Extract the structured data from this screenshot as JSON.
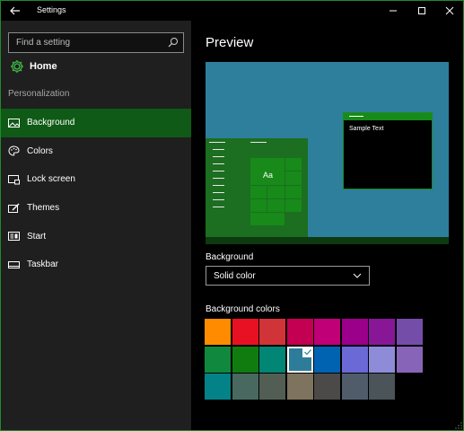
{
  "window": {
    "title": "Settings"
  },
  "search": {
    "placeholder": "Find a setting",
    "value": ""
  },
  "home": {
    "label": "Home"
  },
  "sidebar": {
    "section_label": "Personalization",
    "items": [
      {
        "label": "Background",
        "icon": "picture-icon",
        "active": true
      },
      {
        "label": "Colors",
        "icon": "palette-icon",
        "active": false
      },
      {
        "label": "Lock screen",
        "icon": "lock-screen-icon",
        "active": false
      },
      {
        "label": "Themes",
        "icon": "brush-icon",
        "active": false
      },
      {
        "label": "Start",
        "icon": "start-icon",
        "active": false
      },
      {
        "label": "Taskbar",
        "icon": "taskbar-icon",
        "active": false
      }
    ]
  },
  "main": {
    "title": "Preview",
    "preview": {
      "tile_text": "Aa",
      "window_text": "Sample Text"
    },
    "background": {
      "label": "Background",
      "selected": "Solid color"
    },
    "colors": {
      "label": "Background colors",
      "selected_index": 11,
      "swatches": [
        "#ff8c00",
        "#e81123",
        "#d13438",
        "#c30052",
        "#bf0077",
        "#9a0089",
        "#881798",
        "#744da9",
        "#10893e",
        "#107c10",
        "#018574",
        "#2d7d9a",
        "#0063b1",
        "#6b69d6",
        "#8e8cd8",
        "#8764b8",
        "#038387",
        "#486860",
        "#525e54",
        "#7e735f",
        "#4c4a48",
        "#515c6b",
        "#4a5459"
      ]
    }
  },
  "colors": {
    "accent": "#0f5a16",
    "sidebar_bg": "#1f1f1f",
    "preview_bg": "#2d7f9c"
  }
}
